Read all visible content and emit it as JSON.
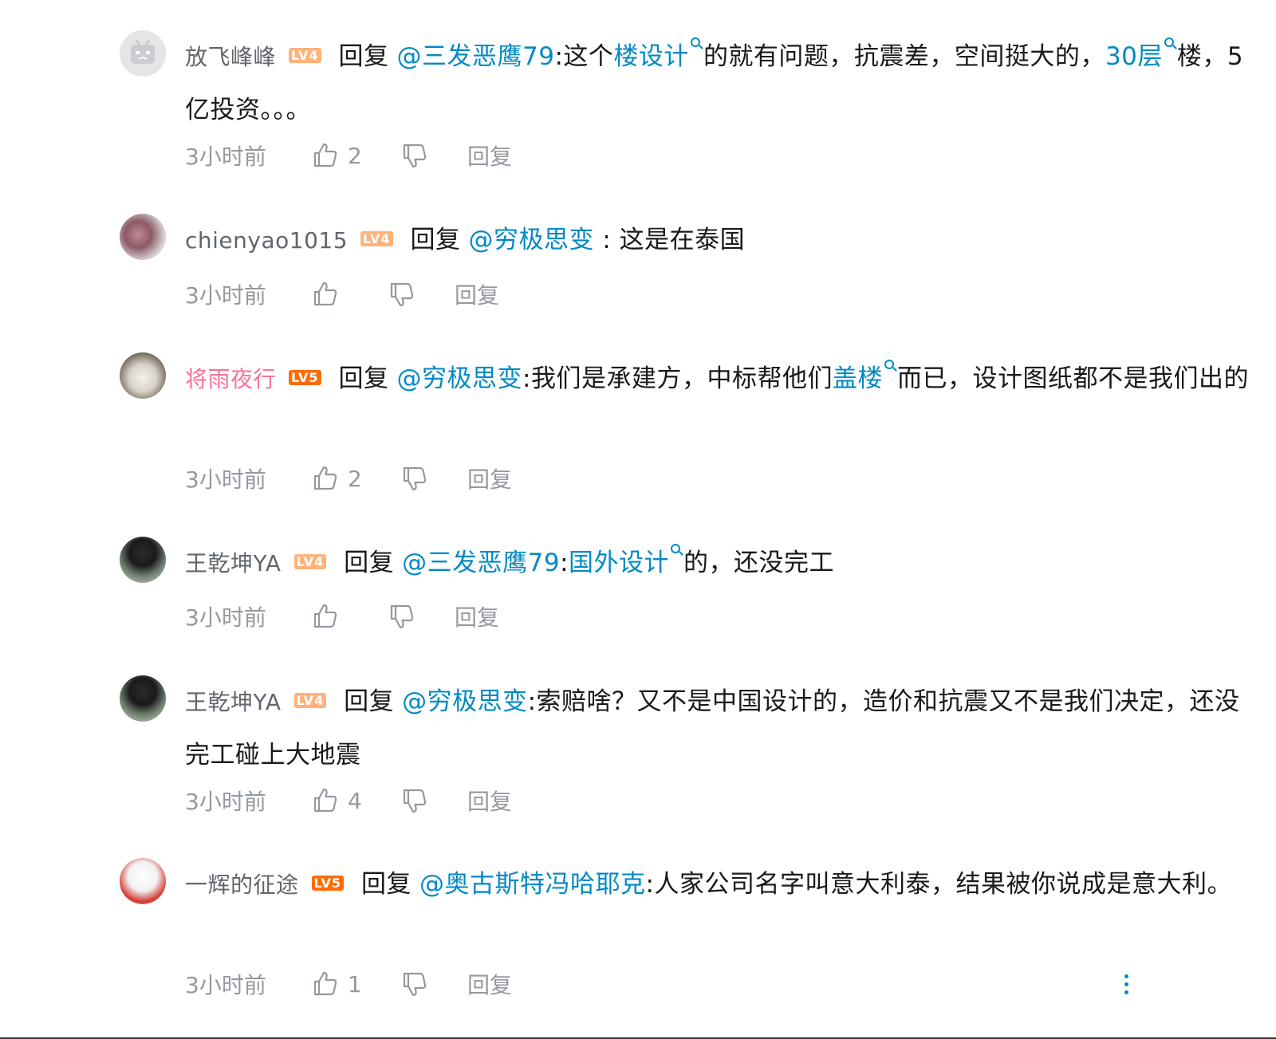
{
  "comments": [
    {
      "user": "放飞峰峰",
      "level": "LV4",
      "reply_word": "回复",
      "at": "@三发恶鹰79",
      "parts": [
        {
          "t": ":这个"
        },
        {
          "k": "楼设计"
        },
        {
          "t": "的就有问题，抗震差，空间挺大的，"
        },
        {
          "k": "30层"
        },
        {
          "t": "楼，5亿投资。。。"
        }
      ],
      "time": "3小时前",
      "likes": "2",
      "reply_label": "回复"
    },
    {
      "user": "chienyao1015",
      "level": "LV4",
      "reply_word": "回复",
      "at": "@穷极思变",
      "parts": [
        {
          "t": " : 这是在泰国"
        }
      ],
      "time": "3小时前",
      "likes": "",
      "reply_label": "回复"
    },
    {
      "user": "将雨夜行",
      "level": "LV5",
      "reply_word": "回复",
      "at": "@穷极思变",
      "parts": [
        {
          "t": ":我们是承建方，中标帮他们"
        },
        {
          "k": "盖楼"
        },
        {
          "t": "而已，设计图纸都不是我们出的"
        }
      ],
      "time": "3小时前",
      "likes": "2",
      "reply_label": "回复"
    },
    {
      "user": "王乾坤YA",
      "level": "LV4",
      "reply_word": "回复",
      "at": "@三发恶鹰79",
      "parts": [
        {
          "t": ":"
        },
        {
          "k": "国外设计"
        },
        {
          "t": "的，还没完工"
        }
      ],
      "time": "3小时前",
      "likes": "",
      "reply_label": "回复"
    },
    {
      "user": "王乾坤YA",
      "level": "LV4",
      "reply_word": "回复",
      "at": "@穷极思变",
      "parts": [
        {
          "t": ":索赔啥？又不是中国设计的，造价和抗震又不是我们决定，还没完工碰上大地震"
        }
      ],
      "time": "3小时前",
      "likes": "4",
      "reply_label": "回复"
    },
    {
      "user": "一辉的征途",
      "level": "LV5",
      "reply_word": "回复",
      "at": "@奥古斯特冯哈耶克",
      "parts": [
        {
          "t": ":人家公司名字叫意大利泰，结果被你说成是意大利。"
        }
      ],
      "time": "3小时前",
      "likes": "1",
      "reply_label": "回复"
    }
  ],
  "icons": {
    "like": "thumb-up-icon",
    "dislike": "thumb-down-icon",
    "more": "more-vertical-icon"
  },
  "colors": {
    "link": "#008ac5",
    "pink_name": "#fb7299",
    "lv4": "#ffb27a",
    "lv5": "#ff6c00",
    "meta": "#9499a0"
  }
}
